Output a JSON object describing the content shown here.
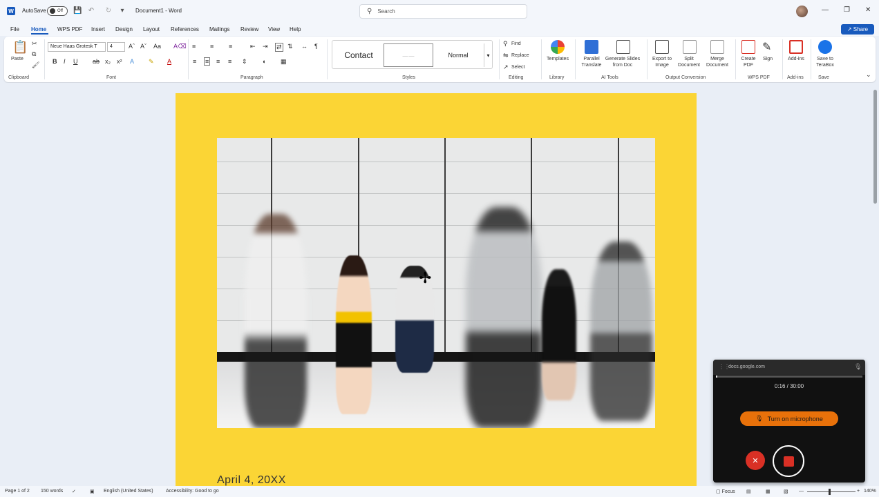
{
  "titlebar": {
    "autosave_label": "AutoSave",
    "autosave_state": "Off",
    "doc_title": "Document1 - Word",
    "search_placeholder": "Search",
    "icons": [
      "word-app-icon",
      "save-icon",
      "undo-icon",
      "redo-icon",
      "customize-icon",
      "avatar",
      "minimize-icon",
      "restore-icon",
      "close-icon"
    ]
  },
  "menu": {
    "tabs": [
      "File",
      "Home",
      "WPS PDF",
      "Insert",
      "Design",
      "Layout",
      "References",
      "Mailings",
      "Review",
      "View",
      "Help"
    ],
    "active_tab": "Home",
    "share_label": "Share"
  },
  "ribbon": {
    "clipboard": {
      "paste": "Paste",
      "label": "Clipboard"
    },
    "font": {
      "font_name": "Neue Haas Grotesk T",
      "font_size": "4",
      "label": "Font"
    },
    "paragraph": {
      "label": "Paragraph"
    },
    "styles": {
      "items": [
        "Contact",
        "",
        "Normal"
      ],
      "selected_index": 1,
      "label": "Styles"
    },
    "editing": {
      "find": "Find",
      "replace": "Replace",
      "select": "Select",
      "label": "Editing"
    },
    "library": {
      "templates": "Templates",
      "label": "Library"
    },
    "ai_tools": {
      "parallel_translate": "Parallel Translate",
      "generate_slides": "Generate Slides from Doc",
      "label": "AI Tools"
    },
    "output_conversion": {
      "export_image": "Export to Image",
      "split_document": "Split Document",
      "merge_document": "Merge Document",
      "label": "Output Conversion"
    },
    "wps_pdf": {
      "create_pdf": "Create PDF",
      "sign": "Sign",
      "label": "WPS PDF"
    },
    "addins": {
      "addins": "Add-ins",
      "label": "Add-ins"
    },
    "save": {
      "save_terabox": "Save to TeraBox",
      "label": "Save"
    }
  },
  "document": {
    "page_color": "#fbd535",
    "date_text": "April 4, 20XX"
  },
  "statusbar": {
    "page": "Page 1 of 2",
    "words": "150 words",
    "language": "English (United States)",
    "accessibility": "Accessibility: Good to go",
    "focus": "Focus",
    "zoom": "140%"
  },
  "recorder": {
    "url": "docs.google.com",
    "time": "0:16 / 30:00",
    "progress": 0.009,
    "mic_button": "Turn on microphone",
    "accent_color": "#e8710a",
    "stop_color": "#d93025"
  }
}
